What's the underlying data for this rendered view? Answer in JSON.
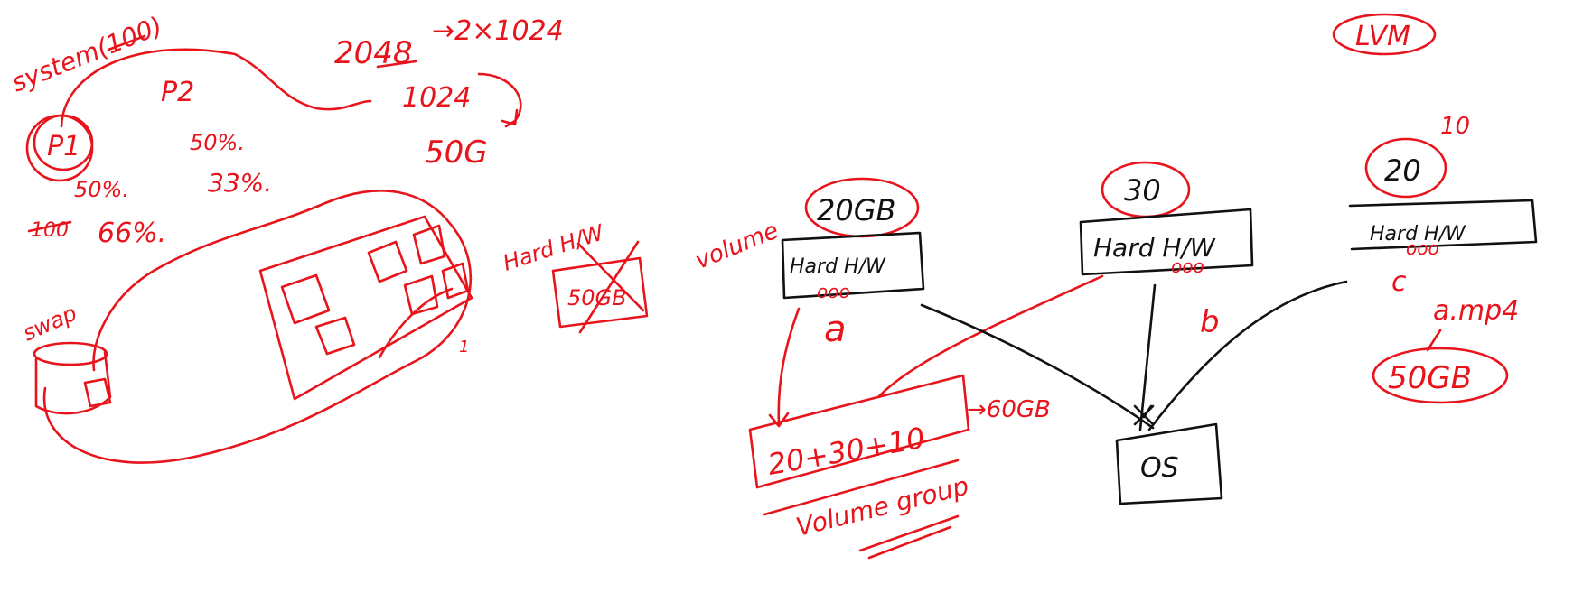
{
  "colors": {
    "ink_red": "#e8141c",
    "ink_black": "#111111",
    "background": "#ffffff"
  },
  "left": {
    "system": "system(100)",
    "p1": "P1",
    "p1_pct_a": "50%.",
    "p1_pct_b": "100",
    "p1_pct_c": "66%.",
    "p2": "P2",
    "p2_pct_a": "50%.",
    "p2_pct_b": "33%.",
    "calc_a": "2048",
    "calc_b": "→2×1024",
    "calc_c": "1024",
    "calc_d": "50G",
    "swap": "swap",
    "hdd_label": "Hard H/W",
    "hdd_value": "50GB",
    "page_mark": "1"
  },
  "right": {
    "title": "LVM",
    "volume": "volume",
    "disks": [
      {
        "size": "20GB",
        "label": "Hard H/W",
        "dots": "ooo",
        "letter": "a"
      },
      {
        "size": "30",
        "label": "Hard H/W",
        "dots": "ooo",
        "letter": "b"
      },
      {
        "size": "20",
        "label": "Hard H/W",
        "dots": "ooo",
        "letter": "c",
        "note": "10"
      }
    ],
    "vg_sum": "20+30+10",
    "vg_total": "→60GB",
    "vg_label": "Volume group",
    "os": "OS",
    "file": "a.mp4",
    "file_size": "50GB"
  }
}
